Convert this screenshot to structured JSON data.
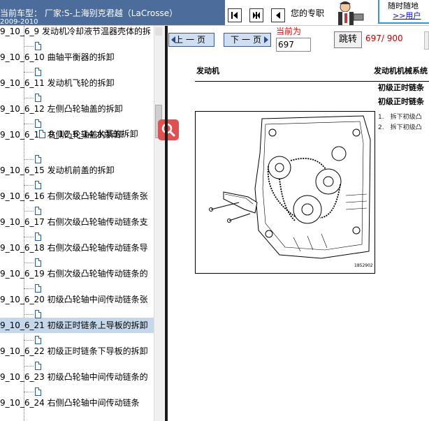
{
  "header": {
    "car_title": "当前车型： 厂家:S-上海别克君越（LaCrosse）",
    "car_year": "2009-2010",
    "nav_buttons": [
      "first-page-icon",
      "fit-page-icon",
      "prev-arrow-icon"
    ],
    "professional_text": "您的专职",
    "promo_line1": "随时随地",
    "promo_line2": ">>用户"
  },
  "tree": {
    "items": [
      {
        "label": "9_10_6_9 发动机冷却液节温器壳体的拆",
        "indent": 0
      },
      {
        "label": "9_10_6_10 曲轴平衡器的拆卸",
        "indent": 0
      },
      {
        "label": "9_10_6_11 发动机飞轮的拆卸",
        "indent": 0
      },
      {
        "label": "9_10_6_12 左侧凸轮轴盖的拆卸",
        "indent": 0
      },
      {
        "label": "9_10_6_13 右侧凸轮轴盖的拆卸",
        "indent": 0
      },
      {
        "label": "9_10_6_14 水泵的拆卸",
        "indent": 1
      },
      {
        "label": "9_10_6_15 发动机前盖的拆卸",
        "indent": 0
      },
      {
        "label": "9_10_6_16 右侧次级凸轮轴传动链条张",
        "indent": 0
      },
      {
        "label": "9_10_6_17 右侧次级凸轮轴传动链条支",
        "indent": 0
      },
      {
        "label": "9_10_6_18 右侧次级凸轮轴传动链条导",
        "indent": 0
      },
      {
        "label": "9_10_6_19 右侧次级凸轮轴传动链条的",
        "indent": 0
      },
      {
        "label": "9_10_6_20 初级凸轮轴中间传动链条张",
        "indent": 0
      },
      {
        "label": "9_10_6_21 初级正时链条上导板的拆卸",
        "indent": 0,
        "selected": true
      },
      {
        "label": "9_10_6_22 初级正时链条下导板的拆卸",
        "indent": 0
      },
      {
        "label": "9_10_6_23 初级凸轮轴中间传动链条的",
        "indent": 0
      },
      {
        "label": "9_10_6_24 右侧凸轮轴中间传动链条",
        "indent": 0
      }
    ]
  },
  "toolbar": {
    "prev_label": "上一页",
    "next_label": "下一页",
    "current_label": "当前为",
    "current_page": "697",
    "jump_label": "跳转",
    "page_count": "697/ 900",
    "search_icon": "magnifier-icon"
  },
  "document": {
    "head_left": "发动机",
    "head_right": "发动机机械系统",
    "side_title_1": "初级正时链条",
    "side_title_2": "初级正时链条",
    "steps": [
      "1.　拆下初级凸",
      "2.　拆下初级凸"
    ],
    "figure_code": "1852902"
  },
  "colors": {
    "title_strip": "#4c6c9c",
    "selected_row": "#c5d7ea",
    "divider": "#1a1a1a",
    "accent_red": "#e00000",
    "button_blue": "#cfdef0"
  }
}
